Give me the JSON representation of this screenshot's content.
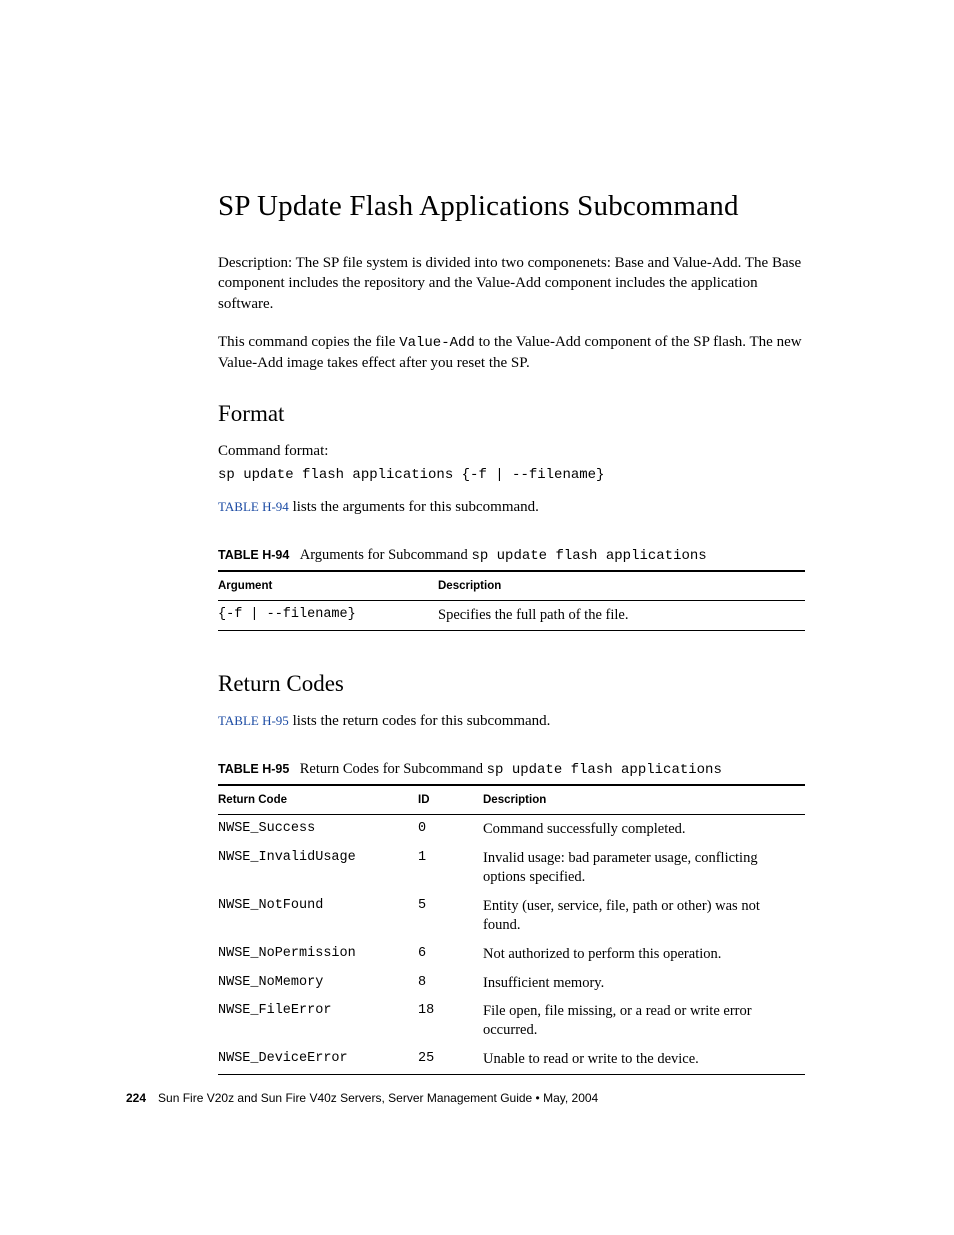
{
  "title": "SP Update Flash Applications Subcommand",
  "para1": "Description: The SP file system is divided into two componenets: Base and Value-Add. The Base component includes the repository and the Value-Add component includes the application software.",
  "para2_pre": "This command copies the file ",
  "para2_mono": "Value-Add",
  "para2_post": " to the Value-Add component of the SP flash. The new Value-Add image takes effect after you reset the SP.",
  "section_format": "Format",
  "cmd_format_label": "Command format:",
  "cmd_format_code": "sp update flash applications {-f | --filename}",
  "ref94_link": "TABLE H-94",
  "ref94_rest": " lists the arguments for this subcommand.",
  "table94": {
    "label": "TABLE H-94",
    "caption_pre": "Arguments for Subcommand ",
    "caption_mono": "sp update flash applications",
    "head_arg": "Argument",
    "head_desc": "Description",
    "row": {
      "arg": "{-f | --filename}",
      "desc": "Specifies the full path of the file."
    }
  },
  "section_return": "Return Codes",
  "ref95_link": "TABLE H-95",
  "ref95_rest": " lists the return codes for this subcommand.",
  "table95": {
    "label": "TABLE H-95",
    "caption_pre": "Return Codes for Subcommand ",
    "caption_mono": "sp update flash applications",
    "head_rc": "Return Code",
    "head_id": "ID",
    "head_desc": "Description",
    "rows": [
      {
        "rc": "NWSE_Success",
        "id": "0",
        "desc": "Command successfully completed."
      },
      {
        "rc": "NWSE_InvalidUsage",
        "id": "1",
        "desc": "Invalid usage: bad parameter usage, conflicting options specified."
      },
      {
        "rc": "NWSE_NotFound",
        "id": "5",
        "desc": "Entity (user, service, file, path or other) was not found."
      },
      {
        "rc": "NWSE_NoPermission",
        "id": "6",
        "desc": "Not authorized to perform this operation."
      },
      {
        "rc": "NWSE_NoMemory",
        "id": "8",
        "desc": "Insufficient memory."
      },
      {
        "rc": "NWSE_FileError",
        "id": "18",
        "desc": "File open, file missing, or a read or write error occurred."
      },
      {
        "rc": "NWSE_DeviceError",
        "id": "25",
        "desc": "Unable to read or write to the device."
      }
    ]
  },
  "footer": {
    "page": "224",
    "text": "Sun Fire V20z and Sun Fire V40z Servers, Server Management Guide • May, 2004"
  }
}
